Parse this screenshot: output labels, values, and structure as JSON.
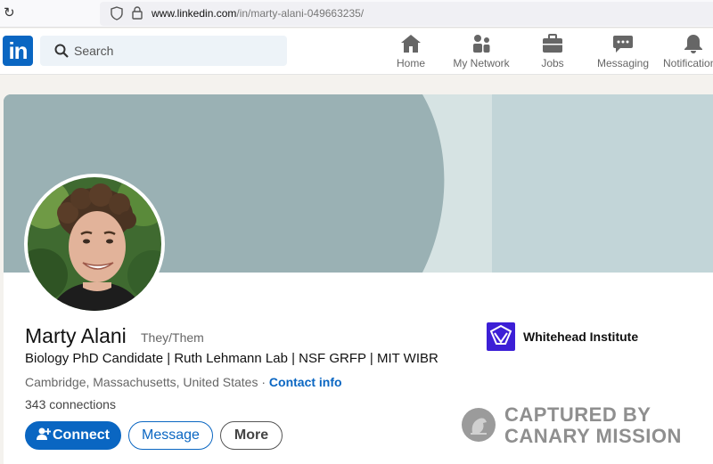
{
  "browser": {
    "url_host": "www.linkedin.com",
    "url_path": "/in/marty-alani-049663235/"
  },
  "nav": {
    "logo_text": "in",
    "search_placeholder": "Search",
    "items": [
      {
        "label": "Home",
        "icon": "home-icon"
      },
      {
        "label": "My Network",
        "icon": "network-icon"
      },
      {
        "label": "Jobs",
        "icon": "briefcase-icon"
      },
      {
        "label": "Messaging",
        "icon": "messaging-icon"
      },
      {
        "label": "Notifications",
        "icon": "bell-icon"
      }
    ]
  },
  "profile": {
    "name": "Marty Alani",
    "pronouns": "They/Them",
    "headline": "Biology PhD Candidate | Ruth Lehmann Lab | NSF GRFP | MIT WIBR",
    "location": "Cambridge, Massachusetts, United States",
    "location_separator": "·",
    "contact_info": "Contact info",
    "connections": "343 connections",
    "organization": "Whitehead Institute",
    "buttons": {
      "connect": "Connect",
      "message": "Message",
      "more": "More"
    }
  },
  "watermark": {
    "line1": "CAPTURED BY",
    "line2": "CANARY MISSION"
  },
  "colors": {
    "brand": "#0a66c2",
    "banner": "#9ab1b4",
    "org_logo": "#3c1fd6"
  }
}
